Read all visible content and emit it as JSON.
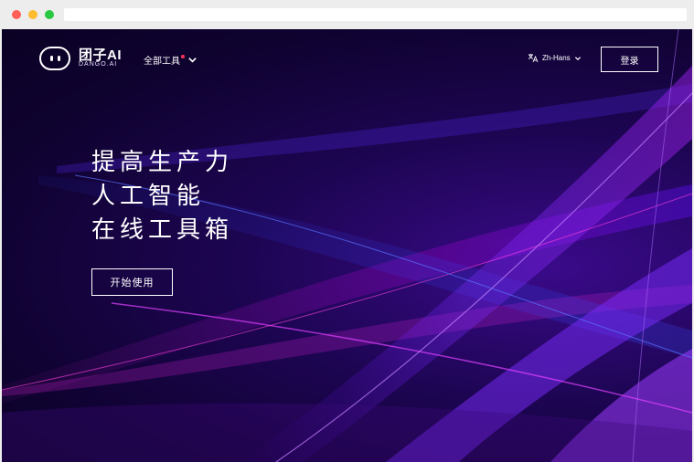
{
  "header": {
    "brand_name": "团子AI",
    "brand_sub": "DANGO.AI",
    "tools_menu_label": "全部工具",
    "language_label": "Zh-Hans",
    "login_label": "登录"
  },
  "hero": {
    "lines": [
      "提高生产力",
      "人工智能",
      "在线工具箱"
    ],
    "cta_label": "开始使用"
  },
  "colors": {
    "background_dark": "#0f0230",
    "accent_purple": "#8a2be2",
    "accent_blue": "#3b3bff",
    "notification_dot": "#ff3355"
  },
  "icons": {
    "logo": "mochi-face-icon",
    "tools_dropdown": "chevron-down-icon",
    "language": "translate-icon",
    "language_dropdown": "chevron-down-icon"
  }
}
